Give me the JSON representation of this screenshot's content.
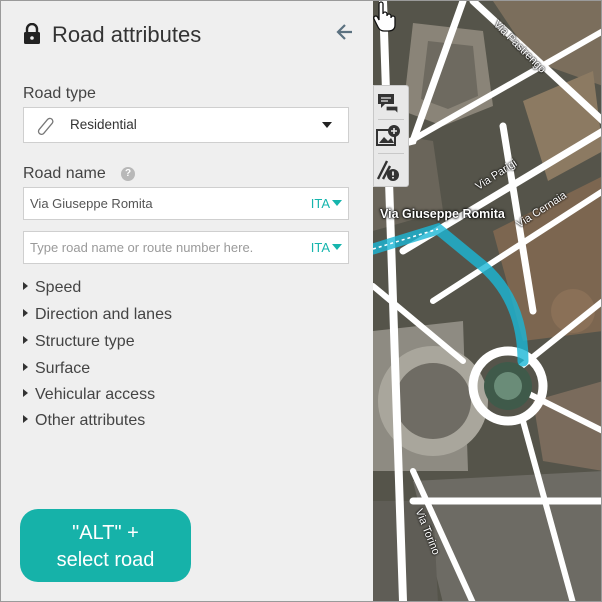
{
  "panel": {
    "title": "Road attributes",
    "road_type": {
      "label": "Road type",
      "value": "Residential",
      "icon": "pencil-icon"
    },
    "road_name": {
      "label": "Road name",
      "help": "?",
      "names": [
        {
          "value": "Via Giuseppe Romita",
          "placeholder": "",
          "lang": "ITA"
        },
        {
          "value": "",
          "placeholder": "Type road name or route number here.",
          "lang": "ITA"
        }
      ]
    },
    "sections": [
      "Speed",
      "Direction and lanes",
      "Structure type",
      "Surface",
      "Vehicular access",
      "Other attributes"
    ],
    "alt_button": {
      "line1": "\"ALT\" +",
      "line2": "select road"
    }
  },
  "map": {
    "selected_road_label": "Via Giuseppe Romita",
    "street_labels": [
      "Via Pastrengo",
      "Via Parigi",
      "Via Cernaia",
      "Via Torino"
    ],
    "tools": [
      "comment-icon",
      "add-image-icon",
      "report-issue-icon"
    ]
  },
  "colors": {
    "accent": "#16b2a9",
    "panel_bg": "#efefef",
    "selection": "#1ab7d6"
  }
}
